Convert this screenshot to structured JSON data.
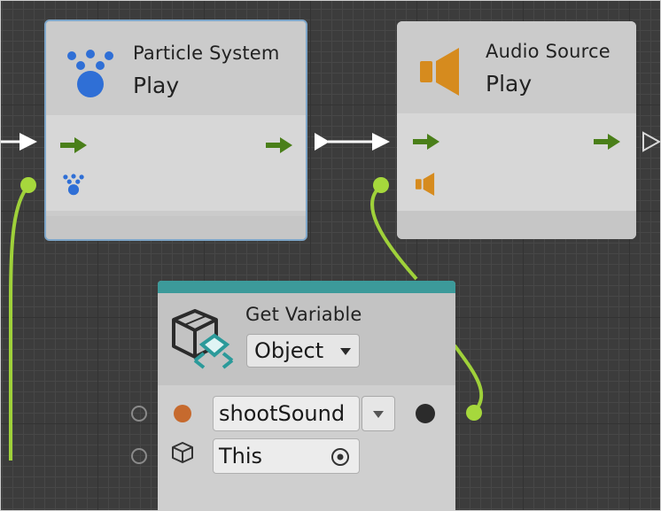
{
  "nodes": {
    "particle_system": {
      "title": "Particle System",
      "subtitle": "Play",
      "icon": "particle-system-icon"
    },
    "audio_source": {
      "title": "Audio Source",
      "subtitle": "Play",
      "icon": "speaker-icon"
    },
    "get_variable": {
      "title": "Get Variable",
      "kind_value": "Object",
      "name_value": "shootSound",
      "target_value": "This",
      "icon": "variable-cube-icon"
    }
  },
  "colors": {
    "flow_arrow": "#4a7f19",
    "wire": "#9fd13a",
    "header_bar": "#3c9a9a",
    "particle_blue": "#2f6fd6",
    "audio_orange": "#d68b1e",
    "kind_dot": "#c66a2e"
  }
}
